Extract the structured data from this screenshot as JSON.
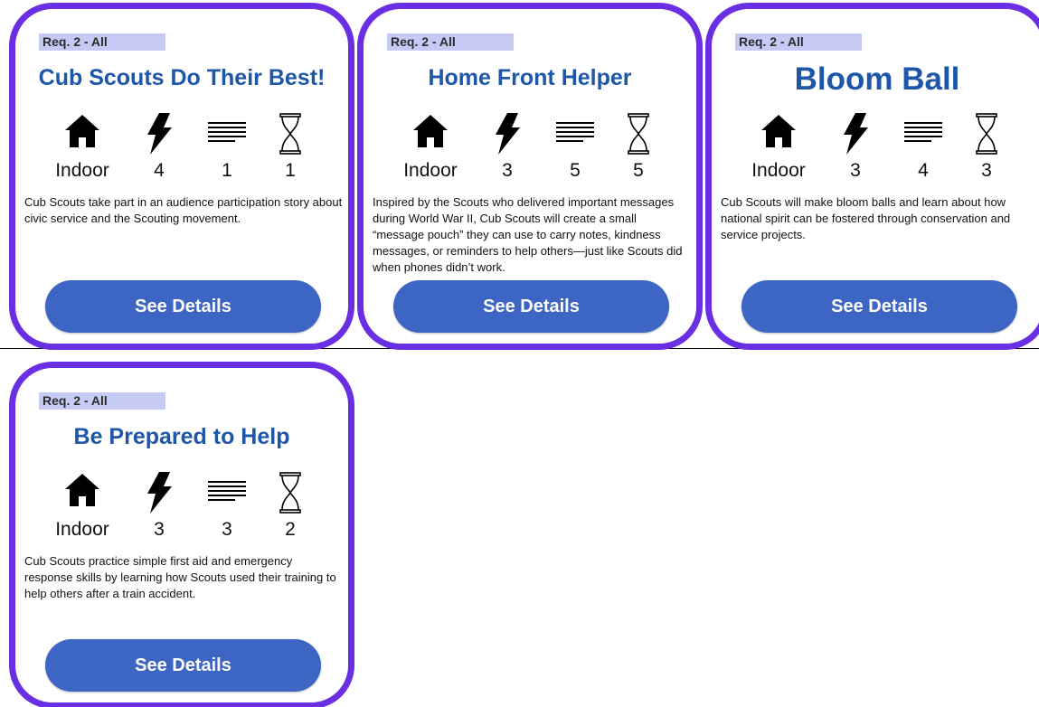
{
  "colors": {
    "card_border": "#6b2fe3",
    "title": "#1e56a8",
    "button": "#3d65c4",
    "req_highlight": "#c5cbf5"
  },
  "icons": {
    "location": "house-icon",
    "energy": "lightning-icon",
    "lines": "text-lines-icon",
    "time": "hourglass-icon"
  },
  "cards": [
    {
      "req": "Req. 2 - All",
      "title": "Cub Scouts Do Their Best!",
      "location": "Indoor",
      "energy": "4",
      "lines": "1",
      "time": "1",
      "description": "Cub Scouts take part in an audience participation story about civic service and the Scouting movement.",
      "button": "See Details"
    },
    {
      "req": "Req. 2 - All",
      "title": "Home Front Helper",
      "location": "Indoor",
      "energy": "3",
      "lines": "5",
      "time": "5",
      "description": "Inspired by the Scouts who delivered important messages during World War II, Cub Scouts will create a small “message pouch” they can use to carry notes, kindness messages, or reminders to help others—just like Scouts did when phones didn’t work.",
      "button": "See Details"
    },
    {
      "req": "Req. 2 - All",
      "title": "Bloom Ball",
      "location": "Indoor",
      "energy": "3",
      "lines": "4",
      "time": "3",
      "description": "Cub Scouts will make bloom balls and learn about how national spirit can be fostered through conservation and service projects.",
      "button": "See Details"
    },
    {
      "req": "Req. 2 - All",
      "title": "Be Prepared to Help",
      "location": "Indoor",
      "energy": "3",
      "lines": "3",
      "time": "2",
      "description": "Cub Scouts practice simple first aid and emergency response skills by learning how Scouts used their training to help others after a train accident.",
      "button": "See Details"
    }
  ]
}
